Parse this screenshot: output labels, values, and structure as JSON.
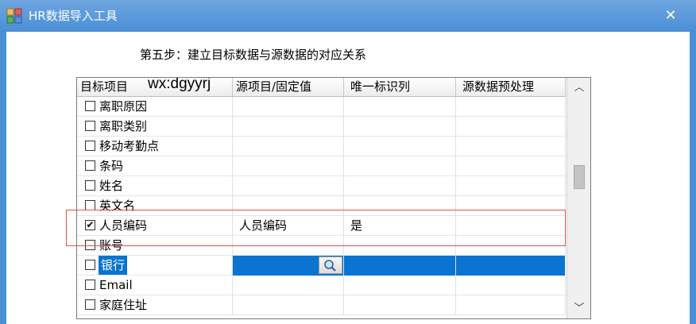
{
  "window": {
    "title": "HR数据导入工具",
    "close_label": "✕"
  },
  "step_title": "第五步：建立目标数据与源数据的对应关系",
  "watermark": "wx:dgyyrj",
  "grid": {
    "columns": [
      "目标项目",
      "源项目/固定值",
      "唯一标识列",
      "源数据预处理"
    ],
    "rows": [
      {
        "target": "离职原因",
        "checked": false,
        "source": "",
        "unique": "",
        "preprocess": ""
      },
      {
        "target": "离职类别",
        "checked": false,
        "source": "",
        "unique": "",
        "preprocess": ""
      },
      {
        "target": "移动考勤点",
        "checked": false,
        "source": "",
        "unique": "",
        "preprocess": ""
      },
      {
        "target": "条码",
        "checked": false,
        "source": "",
        "unique": "",
        "preprocess": ""
      },
      {
        "target": "姓名",
        "checked": false,
        "source": "",
        "unique": "",
        "preprocess": ""
      },
      {
        "target": "英文名",
        "checked": false,
        "source": "",
        "unique": "",
        "preprocess": ""
      },
      {
        "target": "人员编码",
        "checked": true,
        "source": "人员编码",
        "unique": "是",
        "preprocess": ""
      },
      {
        "target": "账号",
        "checked": false,
        "source": "",
        "unique": "",
        "preprocess": ""
      },
      {
        "target": "银行",
        "checked": false,
        "source": "",
        "unique": "",
        "preprocess": "",
        "selected": true
      },
      {
        "target": "Email",
        "checked": false,
        "source": "",
        "unique": "",
        "preprocess": ""
      },
      {
        "target": "家庭住址",
        "checked": false,
        "source": "",
        "unique": "",
        "preprocess": ""
      }
    ],
    "scroll_up_label": "︿",
    "scroll_down_label": "﹀"
  },
  "colors": {
    "titlebar": "#4a8fd6",
    "selection": "#0a74d0",
    "annotation_box": "#e05050"
  },
  "icons": {
    "app": "grid-app-icon",
    "lookup": "magnifier-icon"
  }
}
